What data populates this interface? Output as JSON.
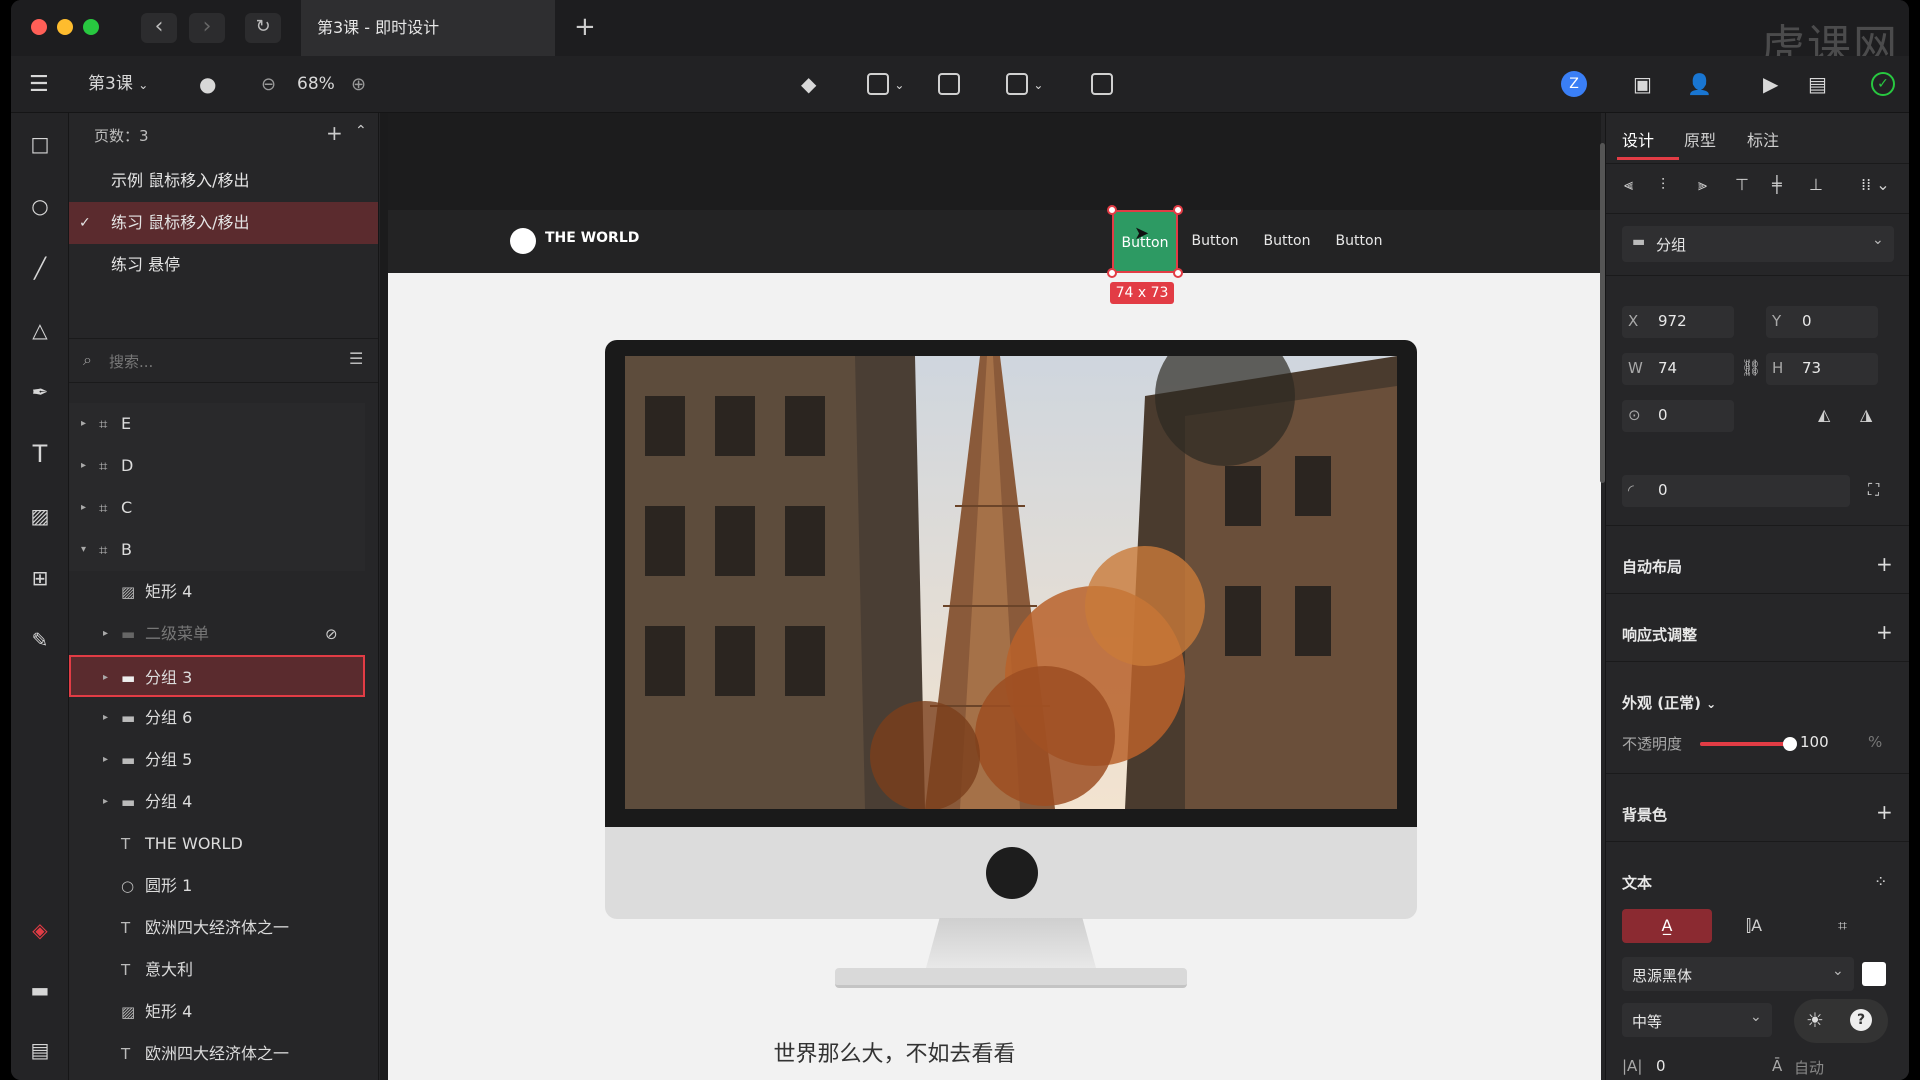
{
  "window": {
    "tab_title": "第3课 - 即时设计",
    "watermark": "虎课网"
  },
  "toolbar": {
    "file_name": "第3课",
    "zoom": "68%",
    "avatar_letter": "Z"
  },
  "pages": {
    "header": "页数：3",
    "items": [
      {
        "label": "示例 鼠标移入/移出"
      },
      {
        "label": "练习 鼠标移入/移出"
      },
      {
        "label": "练习 悬停"
      }
    ]
  },
  "layers": {
    "search_placeholder": "搜索...",
    "items": [
      {
        "label": "E"
      },
      {
        "label": "D"
      },
      {
        "label": "C"
      },
      {
        "label": "B"
      },
      {
        "label": "矩形 4"
      },
      {
        "label": "二级菜单"
      },
      {
        "label": "分组 3"
      },
      {
        "label": "分组 6"
      },
      {
        "label": "分组 5"
      },
      {
        "label": "分组 4"
      },
      {
        "label": "THE WORLD"
      },
      {
        "label": "圆形 1"
      },
      {
        "label": "欧洲四大经济体之一"
      },
      {
        "label": "意大利"
      },
      {
        "label": "矩形 4"
      },
      {
        "label": "欧洲四大经济体之一"
      }
    ]
  },
  "canvas": {
    "logo_text": "THE WORLD",
    "nav_buttons": [
      "Button",
      "Button",
      "Button",
      "Button"
    ],
    "selection_size": "74 x 73",
    "slogan": "世界那么大，不如去看看"
  },
  "inspector": {
    "tabs": [
      "设计",
      "原型",
      "标注"
    ],
    "group_type": "分组",
    "x_label": "X",
    "x": "972",
    "y_label": "Y",
    "y": "0",
    "w_label": "W",
    "w": "74",
    "h_label": "H",
    "h": "73",
    "rotation": "0",
    "radius": "0",
    "auto_layout": "自动布局",
    "responsive": "响应式调整",
    "appearance": "外观 (正常)",
    "opacity_label": "不透明度",
    "opacity_value": "100",
    "opacity_unit": "%",
    "opacity_level": 1.0,
    "background": "背景色",
    "text_section": "文本",
    "font_family": "思源黑体",
    "font_weight": "中等",
    "letter_spacing": "0",
    "line_height": "自动"
  },
  "colors": {
    "accent": "#e23c45",
    "selected_button": "#2d9a63"
  }
}
